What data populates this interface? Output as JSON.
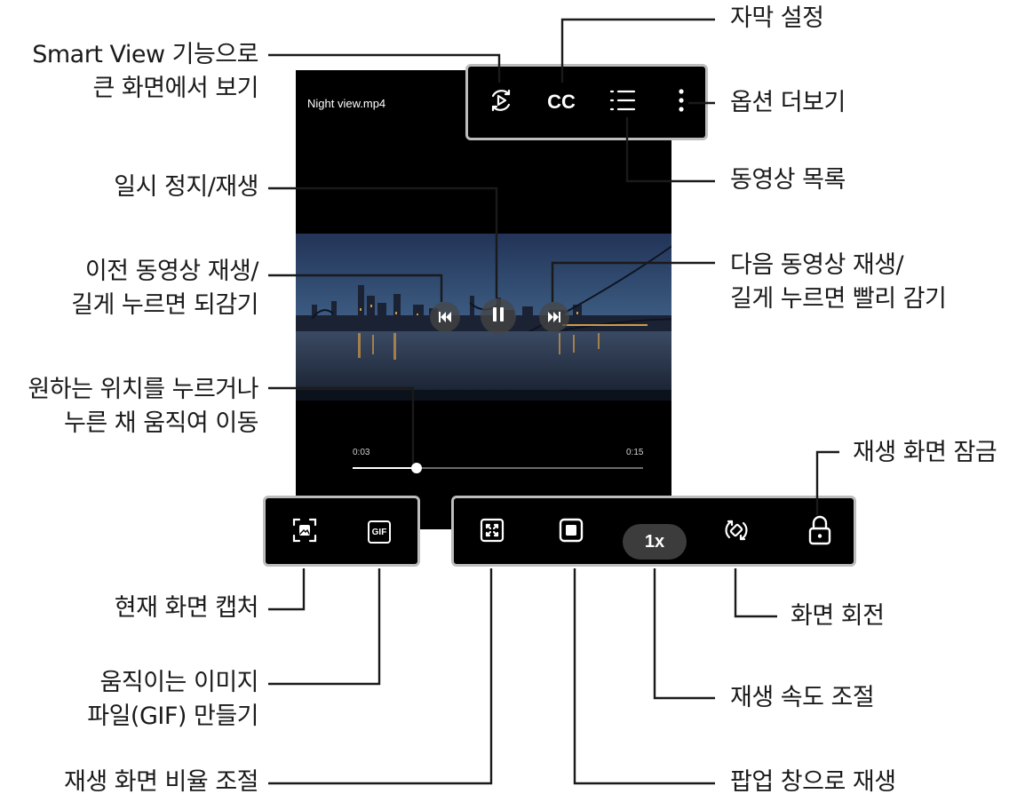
{
  "player": {
    "filename": "Night view.mp4",
    "time_current": "0:03",
    "time_total": "0:15",
    "progress_fraction": 0.22,
    "speed_label": "1x",
    "cc_label": "CC",
    "gif_label": "GIF"
  },
  "icons": {
    "smart_view": "smart-view-icon",
    "subtitles": "cc-icon",
    "playlist": "list-icon",
    "more": "more-vertical-icon",
    "previous": "skip-previous-icon",
    "pause": "pause-icon",
    "next": "skip-next-icon",
    "capture": "screen-capture-icon",
    "gif": "gif-icon",
    "aspect_ratio": "aspect-ratio-icon",
    "popup": "popup-window-icon",
    "rotate": "rotate-icon",
    "lock": "lock-icon"
  },
  "callouts": {
    "smart_view": [
      "Smart View 기능으로",
      "큰 화면에서 보기"
    ],
    "subtitles": [
      "자막 설정"
    ],
    "more_options": [
      "옵션 더보기"
    ],
    "video_list": [
      "동영상 목록"
    ],
    "pause_play": [
      "일시 정지/재생"
    ],
    "previous": [
      "이전 동영상 재생/",
      "길게 누르면 되감기"
    ],
    "next": [
      "다음 동영상 재생/",
      "길게 누르면 빨리 감기"
    ],
    "seek": [
      "원하는 위치를 누르거나",
      "누른 채 움직여 이동"
    ],
    "lock": [
      "재생 화면 잠금"
    ],
    "capture": [
      "현재 화면 캡처"
    ],
    "rotate": [
      "화면 회전"
    ],
    "gif": [
      "움직이는 이미지",
      "파일(GIF) 만들기"
    ],
    "speed": [
      "재생 속도 조절"
    ],
    "aspect_ratio": [
      "재생 화면 비율 조절"
    ],
    "popup": [
      "팝업 창으로 재생"
    ]
  },
  "colors": {
    "panel_border": "#bdbdbd",
    "connector": "#1a1a1a",
    "background": "#ffffff"
  }
}
